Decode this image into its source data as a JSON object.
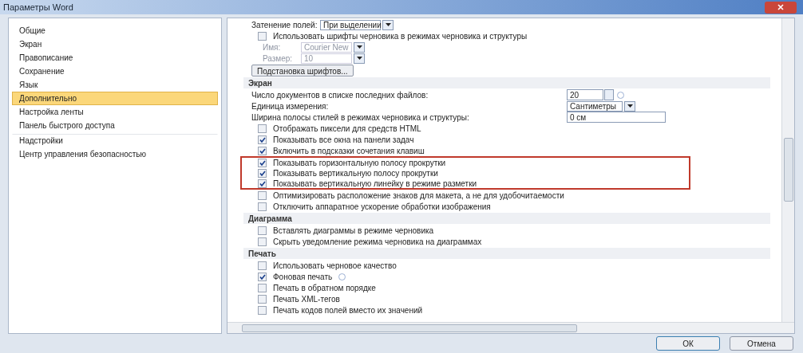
{
  "window": {
    "title": "Параметры Word"
  },
  "sidebar": {
    "items": [
      {
        "label": "Общие",
        "selected": false
      },
      {
        "label": "Экран",
        "selected": false
      },
      {
        "label": "Правописание",
        "selected": false
      },
      {
        "label": "Сохранение",
        "selected": false
      },
      {
        "label": "Язык",
        "selected": false
      },
      {
        "label": "Дополнительно",
        "selected": true
      },
      {
        "label": "Настройка ленты",
        "selected": false
      },
      {
        "label": "Панель быстрого доступа",
        "selected": false
      },
      {
        "label": "Надстройки",
        "selected": false
      },
      {
        "label": "Центр управления безопасностью",
        "selected": false
      }
    ]
  },
  "content": [
    {
      "kind": "select",
      "label": "Затенение полей:",
      "value": "При выделении",
      "disabled": false
    },
    {
      "kind": "checkbox",
      "label": "Использовать шрифты черновика в режимах черновика и структуры",
      "checked": false,
      "highlighted": false
    },
    {
      "kind": "subselect",
      "label": "Имя:",
      "value": "Courier New",
      "disabled": true
    },
    {
      "kind": "subselect",
      "label": "Размер:",
      "value": "10",
      "disabled": true
    },
    {
      "kind": "button",
      "label": "Подстановка шрифтов..."
    },
    {
      "kind": "section",
      "label": "Экран"
    },
    {
      "kind": "spin",
      "label": "Число документов в списке последних файлов:",
      "value": "20"
    },
    {
      "kind": "unitselect",
      "label": "Единица измерения:",
      "value": "Сантиметры",
      "disabled": false
    },
    {
      "kind": "text",
      "label": "Ширина полосы стилей в режимах черновика и структуры:",
      "value": "0 см"
    },
    {
      "kind": "checkbox",
      "label": "Отображать пиксели для средств HTML",
      "checked": false,
      "highlighted": false
    },
    {
      "kind": "checkbox",
      "label": "Показывать все окна на панели задач",
      "checked": true,
      "highlighted": false
    },
    {
      "kind": "checkbox",
      "label": "Включить в подсказки сочетания клавиш",
      "checked": true,
      "highlighted": false
    },
    {
      "kind": "checkbox",
      "label": "Показывать горизонтальную полосу прокрутки",
      "checked": true,
      "highlighted": true
    },
    {
      "kind": "checkbox",
      "label": "Показывать вертикальную полосу прокрутки",
      "checked": true,
      "highlighted": true
    },
    {
      "kind": "checkbox",
      "label": "Показывать вертикальную линейку в режиме разметки",
      "checked": true,
      "highlighted": true
    },
    {
      "kind": "checkbox",
      "label": "Оптимизировать расположение знаков для макета, а не для удобочитаемости",
      "checked": false,
      "highlighted": false
    },
    {
      "kind": "checkbox",
      "label": "Отключить аппаратное ускорение обработки изображения",
      "checked": false,
      "highlighted": false
    },
    {
      "kind": "section",
      "label": "Диаграмма"
    },
    {
      "kind": "checkbox",
      "label": "Вставлять диаграммы в режиме черновика",
      "checked": false,
      "highlighted": false
    },
    {
      "kind": "checkbox",
      "label": "Скрыть уведомление режима черновика на диаграммах",
      "checked": false,
      "highlighted": false
    },
    {
      "kind": "section",
      "label": "Печать"
    },
    {
      "kind": "checkbox",
      "label": "Использовать черновое качество",
      "checked": false,
      "highlighted": false
    },
    {
      "kind": "checkbox",
      "label": "Фоновая печать",
      "checked": true,
      "highlighted": false,
      "info": true
    },
    {
      "kind": "checkbox",
      "label": "Печать в обратном порядке",
      "checked": false,
      "highlighted": false
    },
    {
      "kind": "checkbox",
      "label": "Печать XML-тегов",
      "checked": false,
      "highlighted": false
    },
    {
      "kind": "checkbox",
      "label": "Печать кодов полей вместо их значений",
      "checked": false,
      "highlighted": false
    }
  ],
  "buttons": [
    {
      "label": "ОК"
    },
    {
      "label": "Отмена"
    }
  ]
}
